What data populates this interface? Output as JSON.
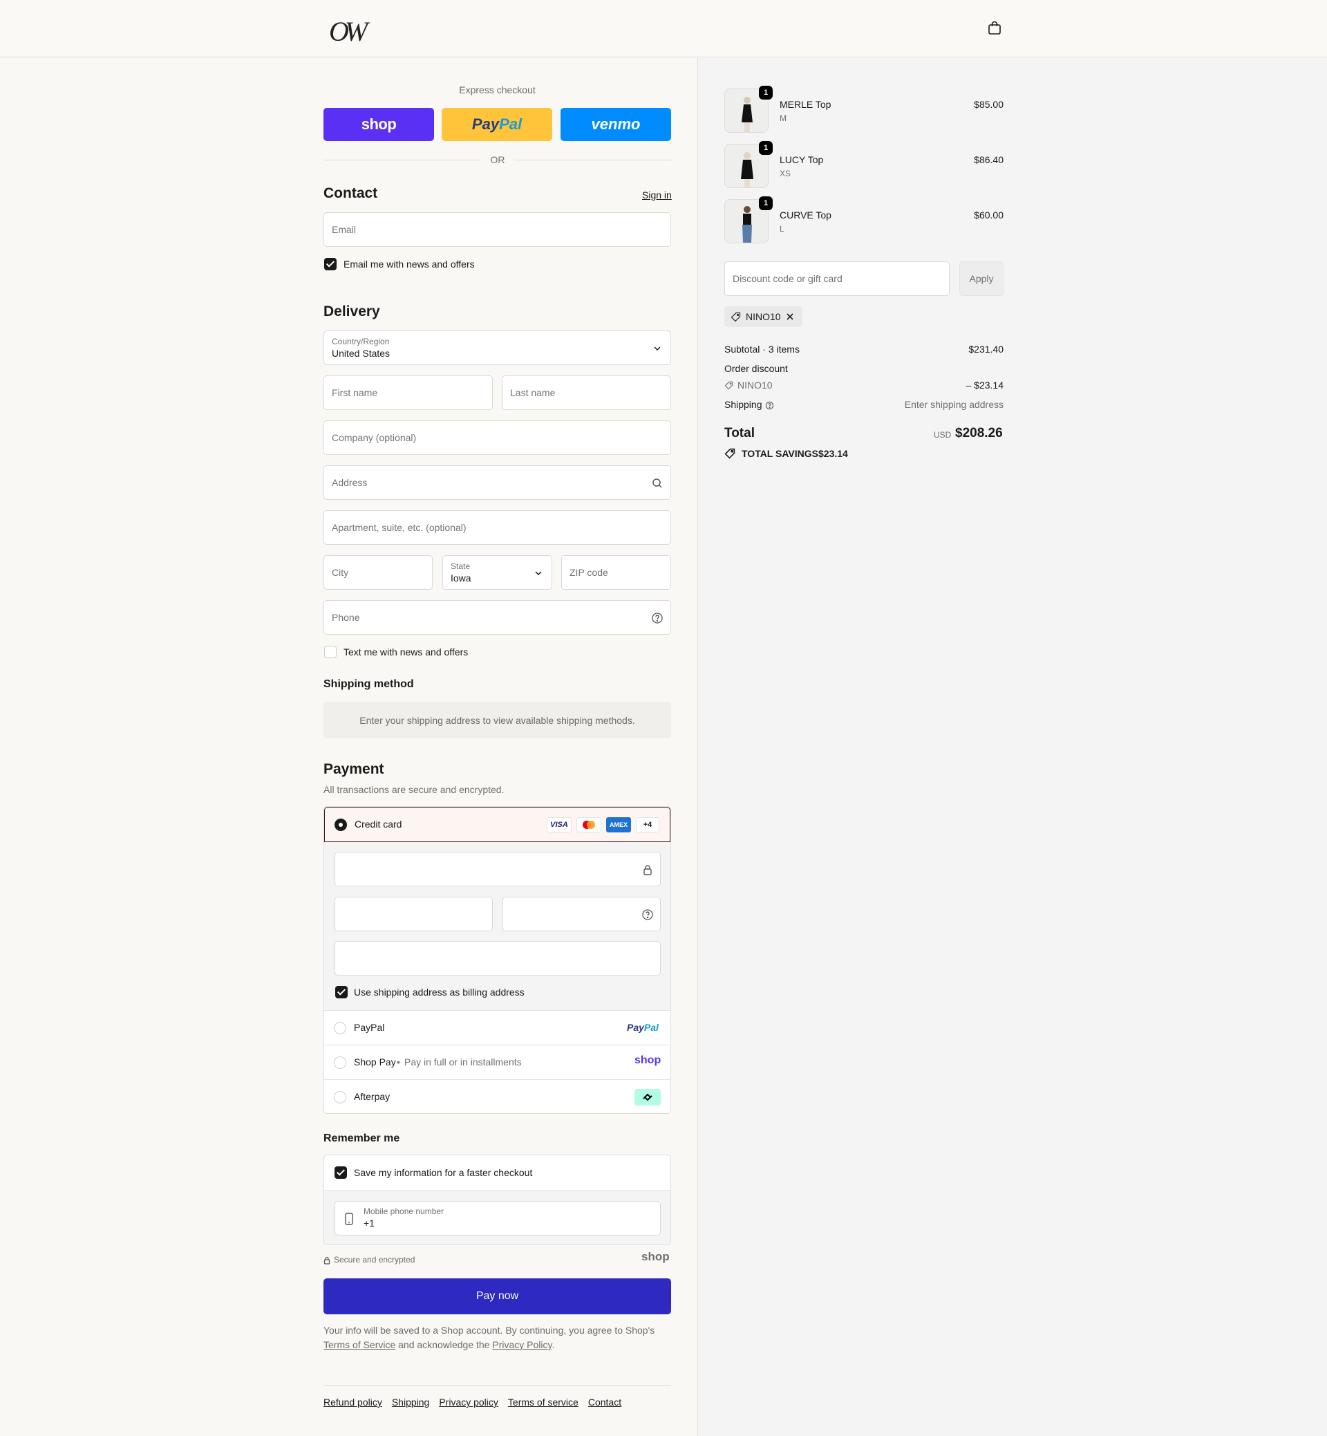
{
  "header": {
    "logo": "OW",
    "cart_icon": "shopping-bag-icon"
  },
  "express": {
    "title": "Express checkout",
    "shop_label": "shop",
    "paypal_label_1": "Pay",
    "paypal_label_2": "Pal",
    "venmo_label": "venmo",
    "or_label": "OR"
  },
  "contact": {
    "title": "Contact",
    "sign_in": "Sign in",
    "email_placeholder": "Email",
    "newsletter_label": "Email me with news and offers",
    "newsletter_checked": true
  },
  "delivery": {
    "title": "Delivery",
    "country_label": "Country/Region",
    "country_value": "United States",
    "first_name": "First name",
    "last_name": "Last name",
    "company": "Company (optional)",
    "address": "Address",
    "apartment": "Apartment, suite, etc. (optional)",
    "city": "City",
    "state_label": "State",
    "state_value": "Iowa",
    "zip": "ZIP code",
    "phone": "Phone",
    "sms_label": "Text me with news and offers",
    "sms_checked": false
  },
  "shipping_method": {
    "title": "Shipping method",
    "message": "Enter your shipping address to view available shipping methods."
  },
  "payment": {
    "title": "Payment",
    "subtitle": "All transactions are secure and encrypted.",
    "credit_card_label": "Credit card",
    "card_brands": [
      "VISA",
      "",
      "AMEX",
      "+4"
    ],
    "billing_label": "Use shipping address as billing address",
    "billing_checked": true,
    "paypal_label": "PayPal",
    "paypal_logo_1": "Pay",
    "paypal_logo_2": "Pal",
    "shoppay_label": "Shop Pay",
    "shoppay_sub": "Pay in full or in installments",
    "shoppay_logo": "shop",
    "afterpay_label": "Afterpay"
  },
  "remember": {
    "title": "Remember me",
    "save_label": "Save my information for a faster checkout",
    "save_checked": true,
    "mobile_label": "Mobile phone number",
    "mobile_value": "+1"
  },
  "secure": {
    "label": "Secure and encrypted",
    "shop_logo": "shop"
  },
  "pay_now": "Pay now",
  "fine_print": {
    "text_1": "Your info will be saved to a Shop account. By continuing, you agree to Shop's",
    "terms_link": "Terms of Service",
    "text_2": "and acknowledge the",
    "privacy_link": "Privacy Policy",
    "text_3": "."
  },
  "footer_links": [
    "Refund policy",
    "Shipping",
    "Privacy policy",
    "Terms of service",
    "Contact"
  ],
  "summary": {
    "items": [
      {
        "name": "MERLE Top",
        "variant": "M",
        "price": "$85.00",
        "qty": "1"
      },
      {
        "name": "LUCY Top",
        "variant": "XS",
        "price": "$86.40",
        "qty": "1"
      },
      {
        "name": "CURVE Top",
        "variant": "L",
        "price": "$60.00",
        "qty": "1"
      }
    ],
    "discount_placeholder": "Discount code or gift card",
    "apply_label": "Apply",
    "applied_code": "NINO10",
    "subtotal_label": "Subtotal · 3 items",
    "subtotal_value": "$231.40",
    "order_discount_label": "Order discount",
    "discount_code": "NINO10",
    "discount_value": "– $23.14",
    "shipping_label": "Shipping",
    "shipping_value": "Enter shipping address",
    "total_label": "Total",
    "currency": "USD",
    "total_value": "$208.26",
    "savings_label": "TOTAL SAVINGS",
    "savings_value": "$23.14"
  },
  "colors": {
    "shop": "#5a31f4",
    "paypal": "#ffc439",
    "venmo": "#008cff",
    "pay_now": "#2d29c1"
  }
}
